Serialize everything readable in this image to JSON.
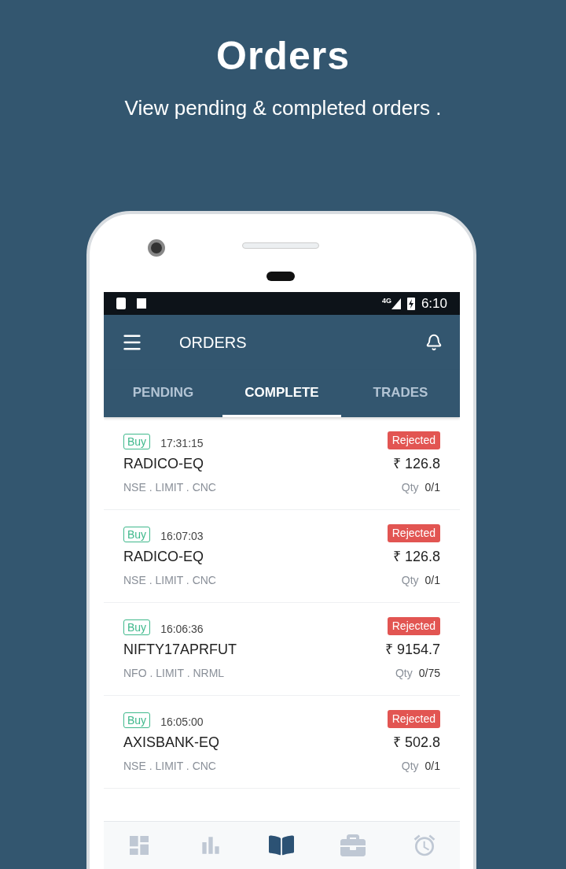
{
  "hero": {
    "title": "Orders",
    "subtitle": "View pending & completed orders ."
  },
  "status_bar": {
    "network": "4G",
    "time": "6:10"
  },
  "app_bar": {
    "title": "ORDERS"
  },
  "tabs": [
    {
      "label": "PENDING",
      "selected": false
    },
    {
      "label": "COMPLETE",
      "selected": true
    },
    {
      "label": "TRADES",
      "selected": false
    }
  ],
  "orders": [
    {
      "side": "Buy",
      "time": "17:31:15",
      "symbol": "RADICO-EQ",
      "details": "NSE . LIMIT . CNC",
      "status": "Rejected",
      "kind": "rejected",
      "price": "₹ 126.8",
      "qty_label": "Qty",
      "qty": "0/1"
    },
    {
      "side": "Buy",
      "time": "16:07:03",
      "symbol": "RADICO-EQ",
      "details": "NSE . LIMIT . CNC",
      "status": "Rejected",
      "kind": "rejected",
      "price": "₹ 126.8",
      "qty_label": "Qty",
      "qty": "0/1"
    },
    {
      "side": "Buy",
      "time": "16:06:36",
      "symbol": "NIFTY17APRFUT",
      "details": "NFO . LIMIT . NRML",
      "status": "Rejected",
      "kind": "rejected",
      "price": "₹ 9154.7",
      "qty_label": "Qty",
      "qty": "0/75"
    },
    {
      "side": "Buy",
      "time": "16:05:00",
      "symbol": "AXISBANK-EQ",
      "details": "NSE . LIMIT . CNC",
      "status": "Rejected",
      "kind": "rejected",
      "price": "₹ 502.8",
      "qty_label": "Qty",
      "qty": "0/1"
    }
  ],
  "bottom_nav": [
    {
      "kind": "dashboard",
      "selected": false
    },
    {
      "kind": "chart",
      "selected": false
    },
    {
      "kind": "book",
      "selected": true
    },
    {
      "kind": "briefcase",
      "selected": false
    },
    {
      "kind": "alarm",
      "selected": false
    }
  ]
}
